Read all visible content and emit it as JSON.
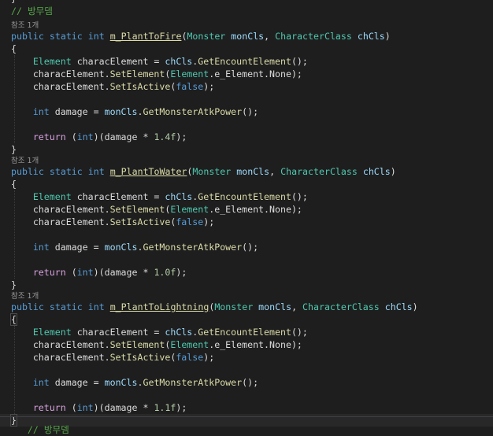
{
  "editor": {
    "theme": {
      "background": "#1e1e1e",
      "keyword": "#569cd6",
      "type": "#4ec9b0",
      "method": "#dcdcaa",
      "comment": "#57a64a",
      "number": "#b5cea8"
    },
    "top_brace": "}",
    "section_comment": "// 방무뎀",
    "ref_count": "참조 1개",
    "kw_public": "public",
    "kw_static": "static",
    "kw_int": "int",
    "kw_return": "return",
    "kw_false": "false",
    "open_brace": "{",
    "close_brace": "}",
    "type_element": "Element",
    "type_monster": "Monster",
    "type_character_class": "CharacterClass",
    "var_charac_element": "characElement",
    "var_mon_cls": "monCls",
    "var_ch_cls": "chCls",
    "var_damage": "damage",
    "m_get_encount": "GetEncountElement",
    "m_set_element": "SetElement",
    "m_set_is_active": "SetIsActive",
    "m_get_atk": "GetMonsterAtkPower",
    "enum_member": "e_Element",
    "enum_none": "None",
    "methods": [
      {
        "name": "m_PlantToFire",
        "factor": "1.4f"
      },
      {
        "name": "m_PlantToWater",
        "factor": "1.0f"
      },
      {
        "name": "m_PlantToLightning",
        "factor": "1.1f"
      }
    ],
    "bottom_partial": "// 방무뎀"
  }
}
